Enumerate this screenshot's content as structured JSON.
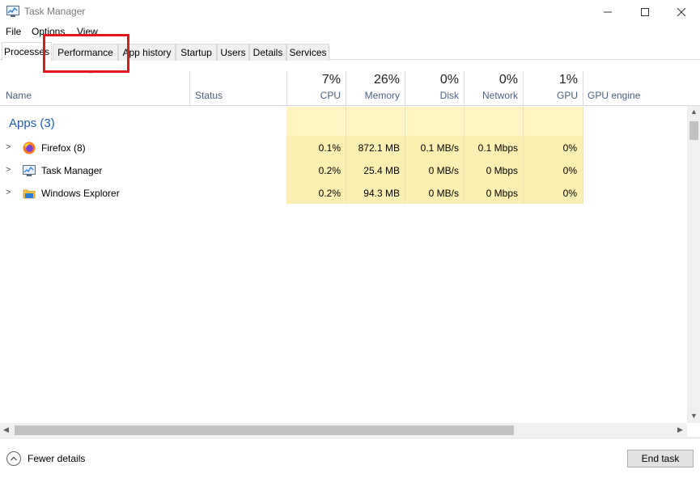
{
  "window": {
    "title": "Task Manager"
  },
  "menu": [
    "File",
    "Options",
    "View"
  ],
  "tabs": [
    "Processes",
    "Performance",
    "App history",
    "Startup",
    "Users",
    "Details",
    "Services"
  ],
  "header": {
    "name": "Name",
    "status": "Status",
    "cpu_pct": "7%",
    "cpu": "CPU",
    "mem_pct": "26%",
    "mem": "Memory",
    "disk_pct": "0%",
    "disk": "Disk",
    "net_pct": "0%",
    "net": "Network",
    "gpu_pct": "1%",
    "gpu": "GPU",
    "gpu_engine": "GPU engine"
  },
  "group": {
    "title": "Apps (3)"
  },
  "rows": [
    {
      "name": "Firefox (8)",
      "cpu": "0.1%",
      "memory": "872.1 MB",
      "disk": "0.1 MB/s",
      "network": "0.1 Mbps",
      "gpu": "0%"
    },
    {
      "name": "Task Manager",
      "cpu": "0.2%",
      "memory": "25.4 MB",
      "disk": "0 MB/s",
      "network": "0 Mbps",
      "gpu": "0%"
    },
    {
      "name": "Windows Explorer",
      "cpu": "0.2%",
      "memory": "94.3 MB",
      "disk": "0 MB/s",
      "network": "0 Mbps",
      "gpu": "0%"
    }
  ],
  "footer": {
    "fewer_details": "Fewer details",
    "end_task": "End task"
  },
  "colors": {
    "highlight": "#e3161c",
    "heat_light": "#fff4c4",
    "heat": "#fbefb2",
    "group_title": "#1f5db7"
  }
}
